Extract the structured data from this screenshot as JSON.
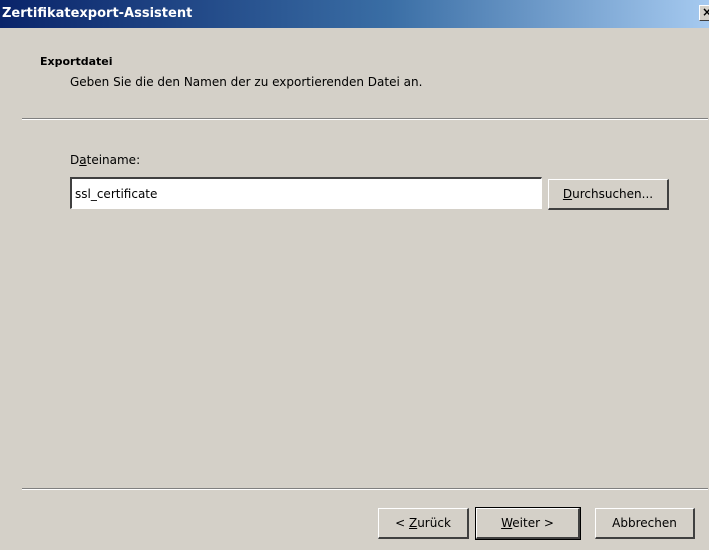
{
  "window": {
    "title": "Zertifikatexport-Assistent",
    "close_symbol": "×"
  },
  "header": {
    "title": "Exportdatei",
    "subtitle": "Geben Sie die den Namen der zu exportierenden Datei an."
  },
  "form": {
    "filename_label_pre": "D",
    "filename_label_mnemonic": "a",
    "filename_label_post": "teiname:",
    "filename_value": "ssl_certificate",
    "browse_mnemonic": "D",
    "browse_rest": "urchsuchen..."
  },
  "footer": {
    "back_pre": "< ",
    "back_mnemonic": "Z",
    "back_rest": "urück",
    "next_mnemonic": "W",
    "next_rest": "eiter >",
    "cancel_label": "Abbrechen"
  },
  "colors": {
    "dialog_bg": "#d4d0c8",
    "titlebar_start": "#0a246a",
    "titlebar_end": "#a6caf0"
  }
}
